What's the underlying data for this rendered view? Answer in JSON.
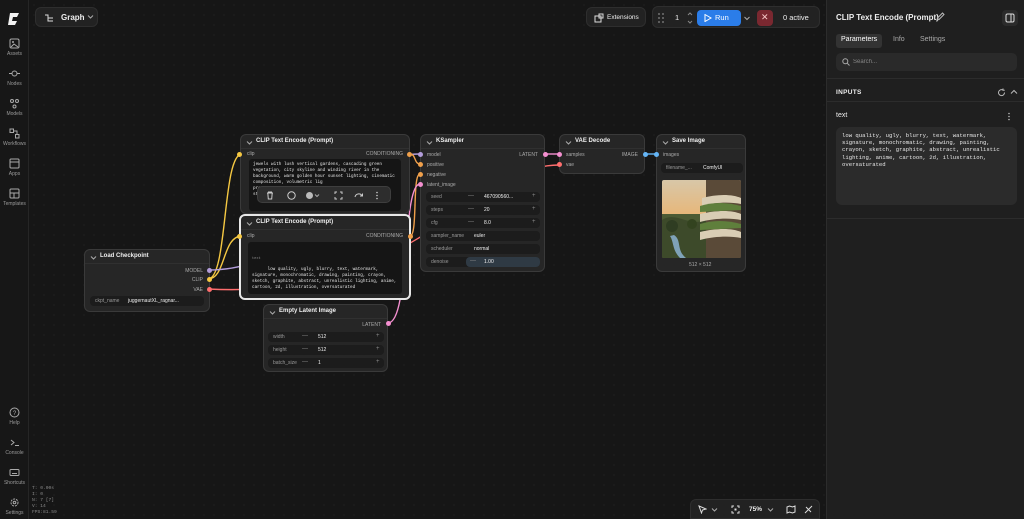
{
  "app": {
    "graph_tab": "Graph",
    "extensions_label": "Extensions",
    "run_count": "1",
    "run_label": "Run",
    "stop_glyph": "✕",
    "active_label": "0 active",
    "zoom": "75%"
  },
  "sidebar": {
    "items": [
      {
        "label": "Assets",
        "icon": "assets-icon"
      },
      {
        "label": "Nodes",
        "icon": "nodes-icon"
      },
      {
        "label": "Models",
        "icon": "models-icon"
      },
      {
        "label": "Workflows",
        "icon": "workflows-icon"
      },
      {
        "label": "Apps",
        "icon": "apps-icon"
      },
      {
        "label": "Templates",
        "icon": "templates-icon"
      }
    ],
    "bottom": [
      {
        "label": "Help",
        "icon": "help-icon"
      },
      {
        "label": "Console",
        "icon": "console-icon"
      },
      {
        "label": "Shortcuts",
        "icon": "keyboard-icon"
      },
      {
        "label": "Settings",
        "icon": "gear-icon"
      }
    ]
  },
  "stats": [
    "T: 0.00s",
    "I: 0",
    "N: 7 [7]",
    "V: 14",
    "FPS:81.59"
  ],
  "nodes": {
    "clip_top": {
      "title": "CLIP Text Encode (Prompt)",
      "in": "clip",
      "out": "CONDITIONING",
      "text": "jewels with lush vertical gardens, cascading green vegetation, city skyline and winding river in the background, warm golden hour sunset lighting, cinematic composition, volumetric lig\npro\nsty"
    },
    "clip_bottom": {
      "title": "CLIP Text Encode (Prompt)",
      "in": "clip",
      "out": "CONDITIONING",
      "widget_name": "text",
      "text": "low quality, ugly, blurry, text, watermark, signature, monochromatic, drawing, painting, crayon, sketch, graphite, abstract, unrealistic lighting, anime, cartoon, 2d, illustration, oversaturated"
    },
    "ksampler": {
      "title": "KSampler",
      "inputs": [
        "model",
        "positive",
        "negative",
        "latent_image"
      ],
      "out": "LATENT",
      "widgets": [
        {
          "label": "seed",
          "value": "467090560..."
        },
        {
          "label": "steps",
          "value": "20"
        },
        {
          "label": "cfg",
          "value": "8.0"
        },
        {
          "label": "sampler_name",
          "value": "euler"
        },
        {
          "label": "scheduler",
          "value": "normal"
        },
        {
          "label": "denoise",
          "value": "1.00"
        }
      ]
    },
    "vae_decode": {
      "title": "VAE Decode",
      "inputs": [
        "samples",
        "vae"
      ],
      "out": "IMAGE"
    },
    "save_image": {
      "title": "Save Image",
      "input": "images",
      "filename_label": "filename_...",
      "filename_value": "ComfyUI",
      "size": "512 × 512"
    },
    "checkpoint": {
      "title": "Load Checkpoint",
      "outputs": [
        "MODEL",
        "CLIP",
        "VAE"
      ],
      "ckpt_label": "ckpt_name",
      "ckpt_value": "juggernautXL_ragnar..."
    },
    "latent": {
      "title": "Empty Latent Image",
      "out": "LATENT",
      "widgets": [
        {
          "label": "width",
          "value": "512"
        },
        {
          "label": "height",
          "value": "512"
        },
        {
          "label": "batch_size",
          "value": "1"
        }
      ]
    }
  },
  "panel": {
    "title": "CLIP Text Encode (Prompt)",
    "tabs": [
      "Parameters",
      "Info",
      "Settings"
    ],
    "search_placeholder": "Search...",
    "section": "INPUTS",
    "field_label": "text",
    "field_value": "low quality, ugly, blurry, text, watermark, signature, monochromatic, drawing, painting, crayon, sketch, graphite, abstract, unrealistic lighting, anime, cartoon, 2d, illustration, oversaturated"
  },
  "colors": {
    "accent": "#2b7de9",
    "clip": "#f5c842",
    "conditioning": "#f0a04b",
    "model": "#b39ddb",
    "latent": "#f48fd0",
    "vae": "#ff6e6e",
    "image": "#64b5f6"
  }
}
